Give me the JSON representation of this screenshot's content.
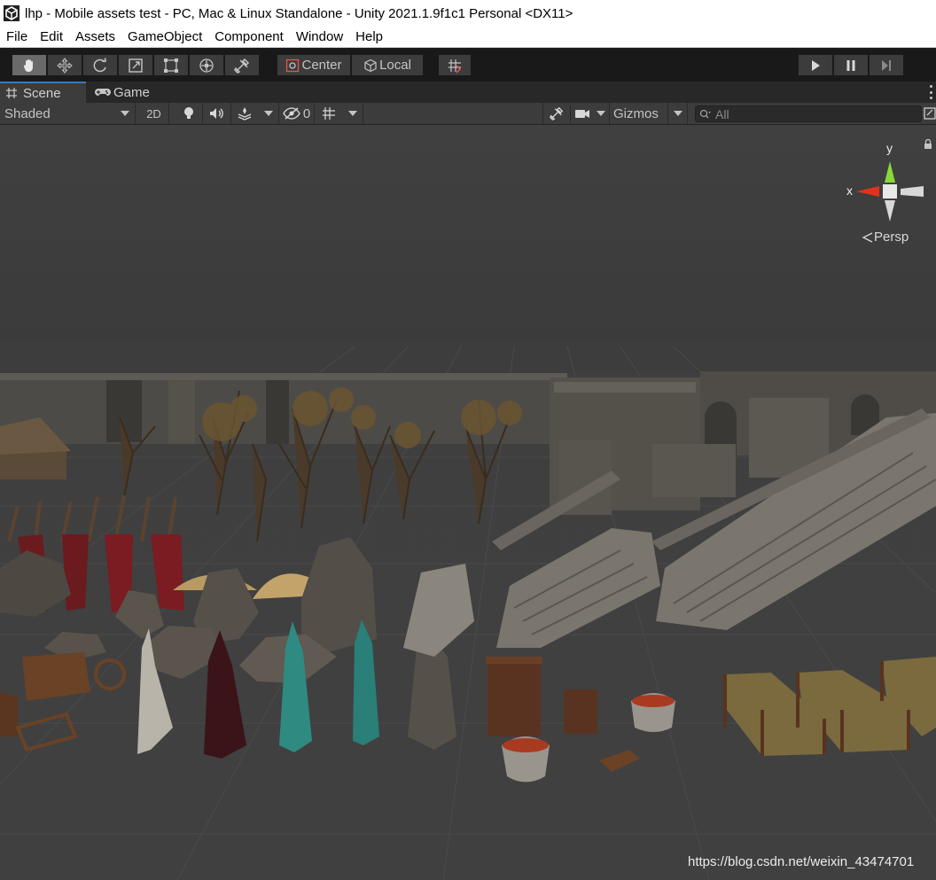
{
  "window": {
    "title": "lhp - Mobile assets test - PC, Mac & Linux Standalone - Unity 2021.1.9f1c1 Personal <DX11>"
  },
  "menu": [
    "File",
    "Edit",
    "Assets",
    "GameObject",
    "Component",
    "Window",
    "Help"
  ],
  "toolbar": {
    "tools": [
      "hand-tool",
      "move-tool",
      "rotate-tool",
      "scale-tool",
      "rect-tool",
      "transform-tool",
      "custom-editor-tool"
    ],
    "active_tool": "hand-tool",
    "pivot_label": "Center",
    "space_label": "Local",
    "playback": [
      "play",
      "pause",
      "step"
    ]
  },
  "tabs": {
    "scene_label": "Scene",
    "game_label": "Game"
  },
  "scene_toolbar": {
    "draw_mode": "Shaded",
    "mode_2d": "2D",
    "hidden_count": "0",
    "gizmos_label": "Gizmos",
    "search_placeholder": "All"
  },
  "scene_view": {
    "axis_y": "y",
    "axis_x": "x",
    "projection_label": "Persp",
    "watermark": "https://blog.csdn.net/weixin_43474701"
  },
  "colors": {
    "axis_x": "#e0321c",
    "axis_y": "#8ad93a",
    "axis_z": "#ececec",
    "tab_accent": "#3a79bb"
  }
}
